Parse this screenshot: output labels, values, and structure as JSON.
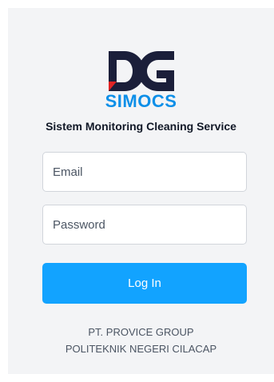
{
  "brand": {
    "logo_icon": "dc-logo-icon",
    "name": "SIMOCS",
    "tagline": "Sistem Monitoring Cleaning Service",
    "colors": {
      "dark": "#1b1f3a",
      "accent_red": "#e02424",
      "blue": "#0d8fe8"
    }
  },
  "form": {
    "email_placeholder": "Email",
    "password_placeholder": "Password",
    "login_label": "Log In",
    "button_color": "#12a3ff"
  },
  "footer": {
    "line1": "PT. PROVICE GROUP",
    "line2": "POLITEKNIK NEGERI CILACAP"
  }
}
